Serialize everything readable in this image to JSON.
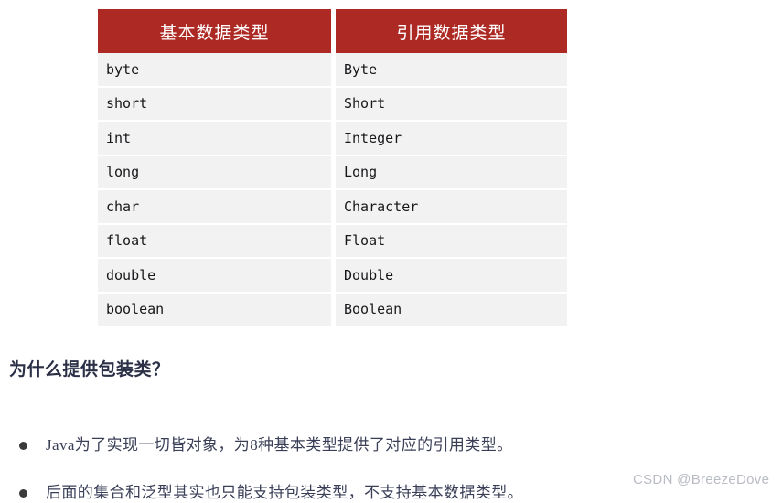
{
  "table": {
    "headers": [
      "基本数据类型",
      "引用数据类型"
    ],
    "header_bg": "#ad2a24",
    "header_text_color": "#ffffff",
    "cell_bg": "#f2f2f2",
    "rows": [
      {
        "primitive": "byte",
        "wrapper": "Byte"
      },
      {
        "primitive": "short",
        "wrapper": "Short"
      },
      {
        "primitive": "int",
        "wrapper": "Integer"
      },
      {
        "primitive": "long",
        "wrapper": "Long"
      },
      {
        "primitive": "char",
        "wrapper": "Character"
      },
      {
        "primitive": "float",
        "wrapper": "Float"
      },
      {
        "primitive": "double",
        "wrapper": "Double"
      },
      {
        "primitive": "boolean",
        "wrapper": "Boolean"
      }
    ]
  },
  "section": {
    "heading": "为什么提供包装类？",
    "heading_color": "#2c3047",
    "bullets": [
      "Java为了实现一切皆对象，为8种基本类型提供了对应的引用类型。",
      "后面的集合和泛型其实也只能支持包装类型，不支持基本数据类型。"
    ]
  },
  "watermark": {
    "text": "CSDN @BreezeDove",
    "color": "#b9bcc4"
  }
}
